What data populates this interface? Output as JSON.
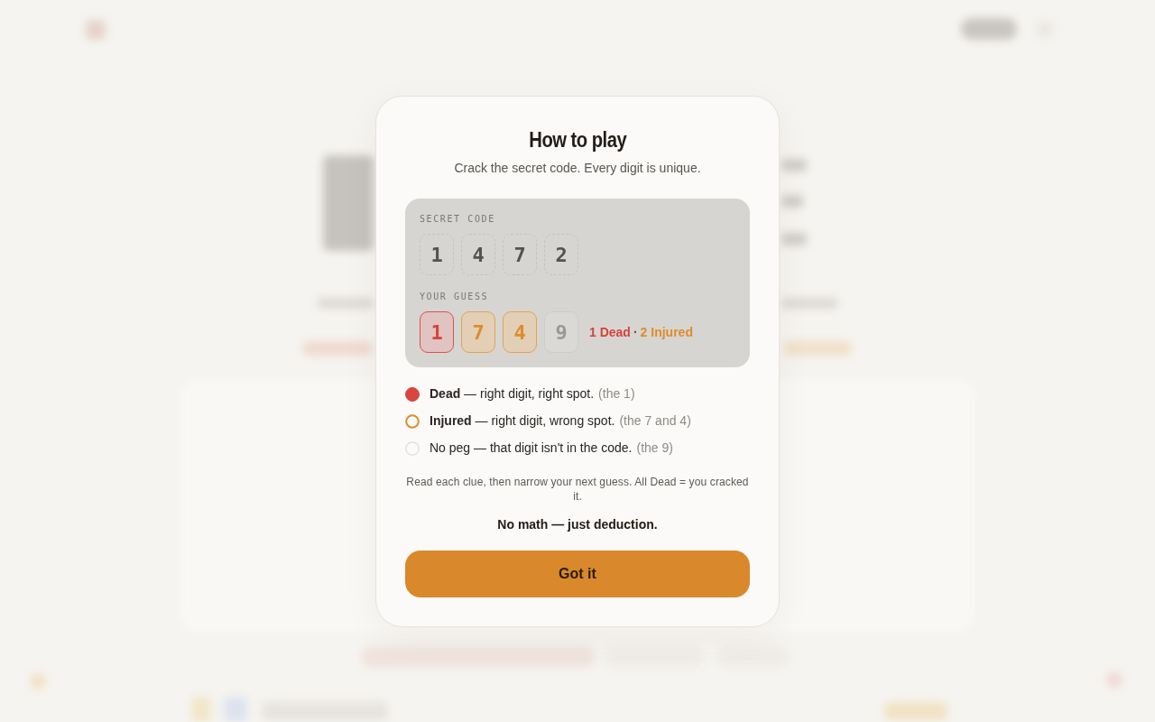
{
  "modal": {
    "title": "How to play",
    "subtitle": "Crack the secret code. Every digit is unique.",
    "example": {
      "secret_label": "SECRET CODE",
      "secret_digits": [
        "1",
        "4",
        "7",
        "2"
      ],
      "guess_label": "YOUR GUESS",
      "guess": [
        {
          "digit": "1",
          "kind": "dead"
        },
        {
          "digit": "7",
          "kind": "injured"
        },
        {
          "digit": "4",
          "kind": "injured"
        },
        {
          "digit": "9",
          "kind": "none"
        }
      ],
      "result": {
        "dead": "1 Dead",
        "separator": "·",
        "injured": "2 Injured"
      }
    },
    "legend": [
      {
        "kind": "dead",
        "text": "**Dead** — right digit, right spot.",
        "hint": "(the 1)"
      },
      {
        "kind": "injured",
        "text": "**Injured** — right digit, wrong spot.",
        "hint": "(the 7 and 4)"
      },
      {
        "kind": "none",
        "text": "No peg — that digit isn't in the code.",
        "hint": "(the 9)"
      }
    ],
    "note": "Read each clue, then narrow your next guess. All Dead = you cracked it.",
    "tagline": "No math — just deduction.",
    "button": "Got it"
  }
}
